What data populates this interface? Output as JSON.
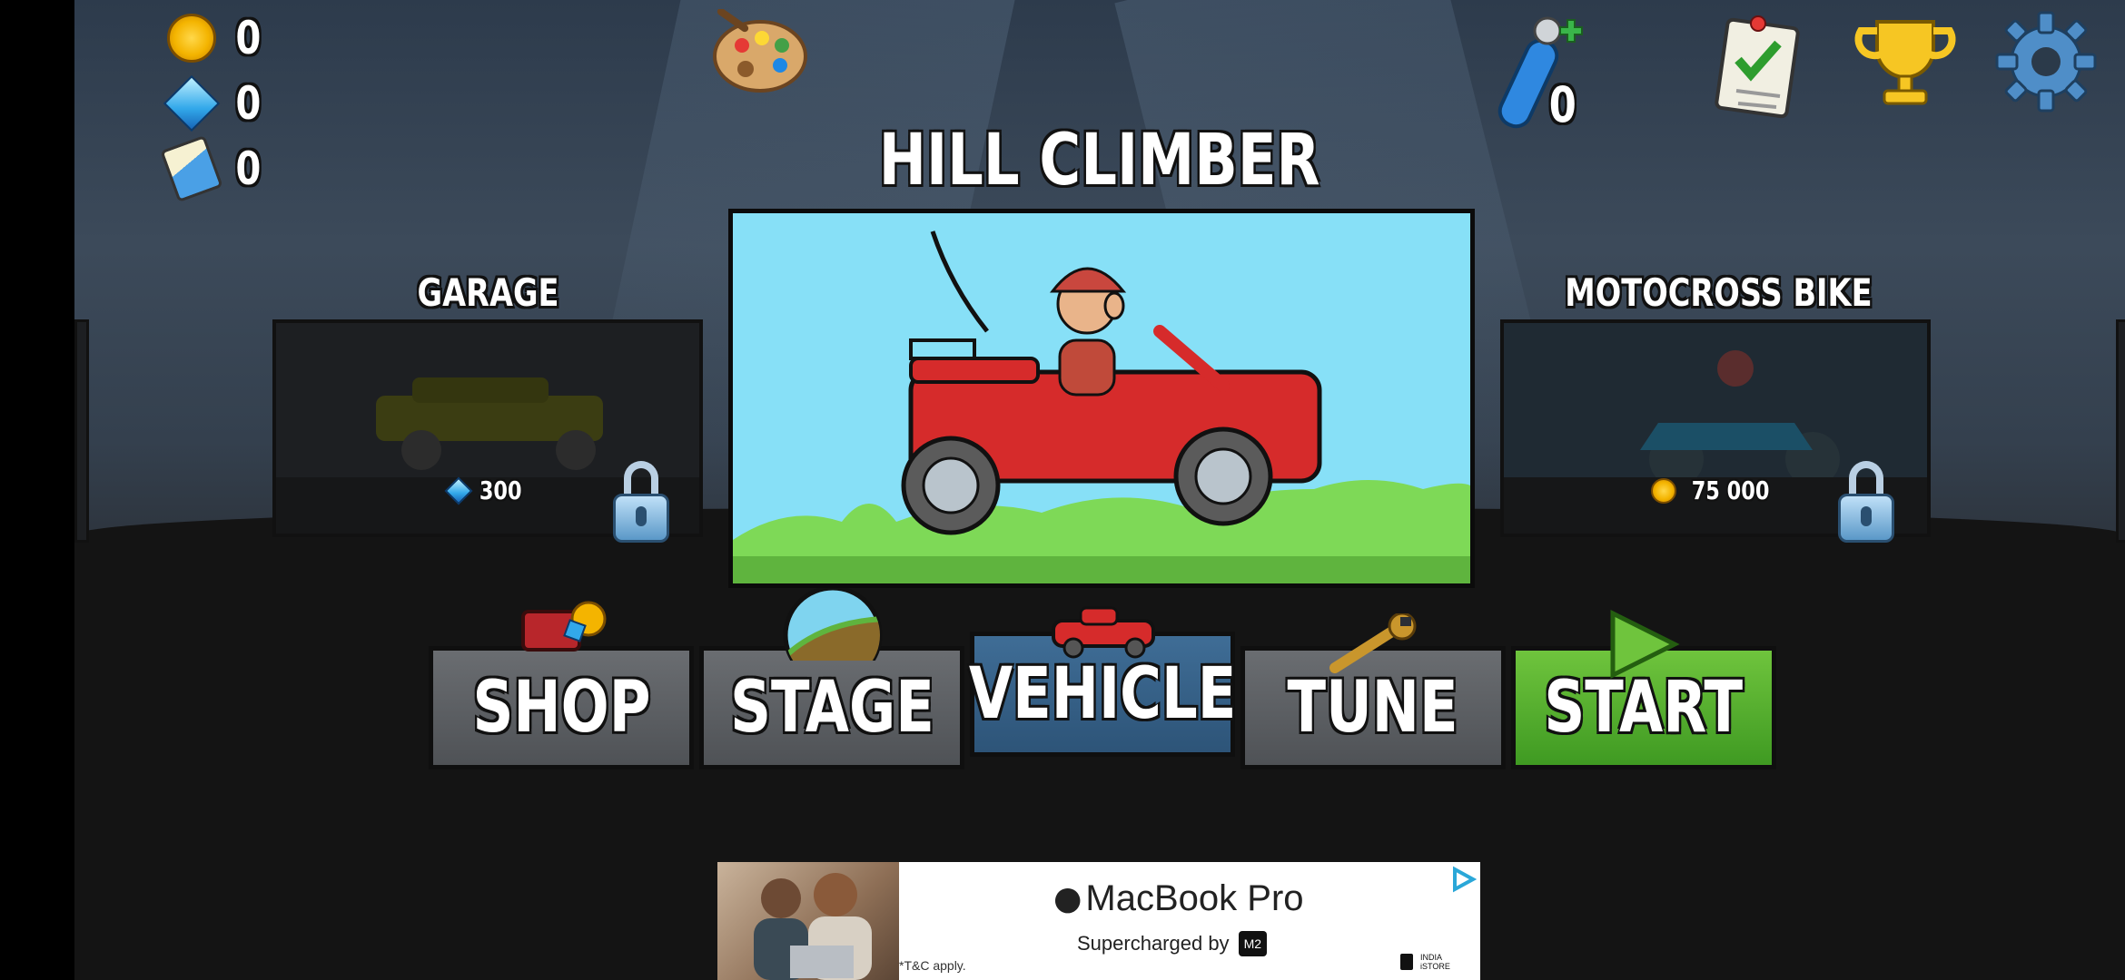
{
  "currency": {
    "coins": "0",
    "gems": "0",
    "fuel_cans": "0"
  },
  "top_right": {
    "boosters": "0"
  },
  "vehicle_select": {
    "selected_title": "HILL CLIMBER",
    "left_card": {
      "title": "GARAGE",
      "price": "300",
      "currency": "gem",
      "locked": true
    },
    "right_card": {
      "title": "MOTOCROSS BIKE",
      "price": "75 000",
      "currency": "coin",
      "locked": true
    }
  },
  "menu": {
    "shop": "SHOP",
    "stage": "STAGE",
    "vehicle": "VEHICLE",
    "tune": "TUNE",
    "start": "START"
  },
  "ad": {
    "brand": "MacBook Pro",
    "tagline": "Supercharged by",
    "chip": "M2",
    "disclaimer": "*T&C apply.",
    "seller_line1": "INDIA",
    "seller_line2": "iSTORE"
  },
  "colors": {
    "sky": "#87e0f7",
    "grass": "#7ed957",
    "car_red": "#d62b2b",
    "start_green": "#4caf2a",
    "vehicle_blue": "#34607f"
  }
}
